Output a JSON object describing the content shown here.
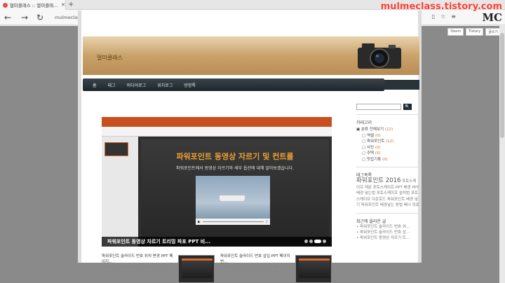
{
  "browser": {
    "tab_title": "멀미클래스 :: 멀미클래...",
    "tab_close": "✕",
    "new_tab": "+",
    "url": "mulmeclass.tistory.com",
    "back": "←",
    "forward": "→",
    "refresh": "↻"
  },
  "watermark": "mulmeclass.tistory.com",
  "logo": "MC",
  "blog_top_links": [
    "Ooom",
    "Tistory",
    "글쓰기"
  ],
  "header": {
    "site_title": "멀미클래스"
  },
  "menu": [
    "홈",
    "태그",
    "미디어로그",
    "위치로그",
    "방명록"
  ],
  "post": {
    "slide_title": "파워포인트 동영상 자르기 및 컨트롤",
    "slide_subtitle": "파워포인트에서 동영상 자르기와 세부 옵션에 대해 알아보겠습니다.",
    "caption": "파워포인트 동영상 자르기 트리밍 파포 PPT 비..."
  },
  "cards": [
    {
      "title": "파워포인트 슬라이드 번호 위치 변경 PPT 페이지...",
      "text": "파워포인트 슬라이드 번호 조절하기 PPT 쪽 번호 바꾸는 방법 이번시간에는 파워 포인트 슬라"
    },
    {
      "title": "파워포인트 슬라이드 번호 삽입 PPT 페이지 번...",
      "text": "파워포인트 슬라이드 번호 넣기 PPT 페이지 번호 설정하기 파포 쪽 바꾸기 파워포인트 기 리"
    }
  ],
  "sidebar": {
    "search_button": "🔍",
    "category_heading": "카테고리",
    "categories": [
      {
        "label": "분류 전체보기",
        "count": "(12)"
      },
      {
        "label": "엑셀",
        "count": "(0)"
      },
      {
        "label": "파워포인트",
        "count": "(12)"
      },
      {
        "label": "사진",
        "count": "(0)"
      },
      {
        "label": "주택",
        "count": "(0)"
      },
      {
        "label": "맛집기록",
        "count": "(0)"
      }
    ],
    "tag_heading": "태그목록",
    "tag_big": "파워포인트 2016",
    "tags_text": "포토스케이프 대문 포토스케이프 PPT 배경 PPT 배경 넣는법 포토스케이프 설치법 포토스케이프 다운로드 파워포인트 배경 넣기 파워포인트 배경넣는 방법 배너 의료",
    "recent_heading": "최근에 올라온 글",
    "recent": [
      "파워포인트 슬라이드 번호 위...",
      "파워포인트 슬라이드 번호 삽...",
      "파워포인트 동영상 자르기 트..."
    ]
  }
}
